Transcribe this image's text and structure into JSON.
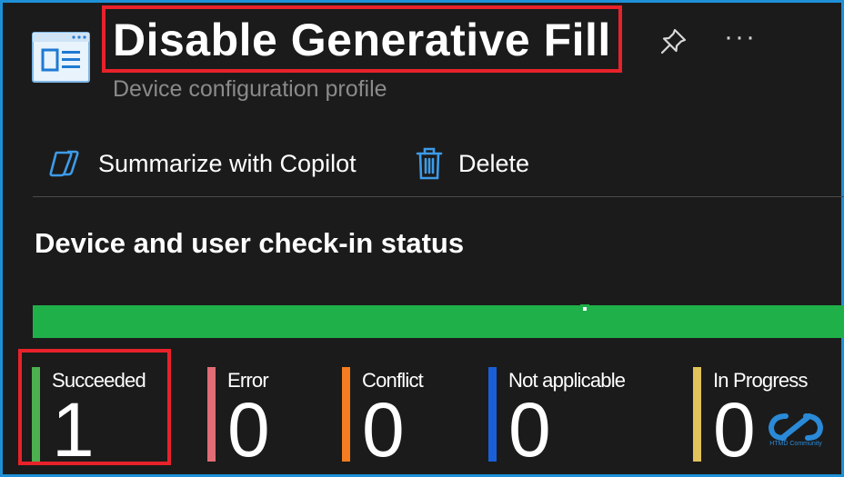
{
  "header": {
    "title": "Disable Generative Fill",
    "subtitle": "Device configuration profile",
    "more_label": "···"
  },
  "toolbar": {
    "summarize_label": "Summarize with Copilot",
    "delete_label": "Delete"
  },
  "status": {
    "section_title": "Device and user check-in status",
    "succeeded_fraction": 1.0,
    "tiles": [
      {
        "label": "Succeeded",
        "count": "1",
        "color": "#4caf50"
      },
      {
        "label": "Error",
        "count": "0",
        "color": "#e06c75"
      },
      {
        "label": "Conflict",
        "count": "0",
        "color": "#f57c20"
      },
      {
        "label": "Not applicable",
        "count": "0",
        "color": "#1a5fd8"
      },
      {
        "label": "In Progress",
        "count": "0",
        "color": "#e2c25a"
      }
    ]
  },
  "watermark": {
    "text": "HTMD Community"
  },
  "colors": {
    "bar_green": "#20b04a",
    "highlight_red": "#e8222a",
    "frame_blue": "#1e90d8"
  },
  "icons": {
    "profile": "settings-window-icon",
    "pin": "pin-icon",
    "copilot": "copilot-icon",
    "delete": "trash-icon"
  }
}
